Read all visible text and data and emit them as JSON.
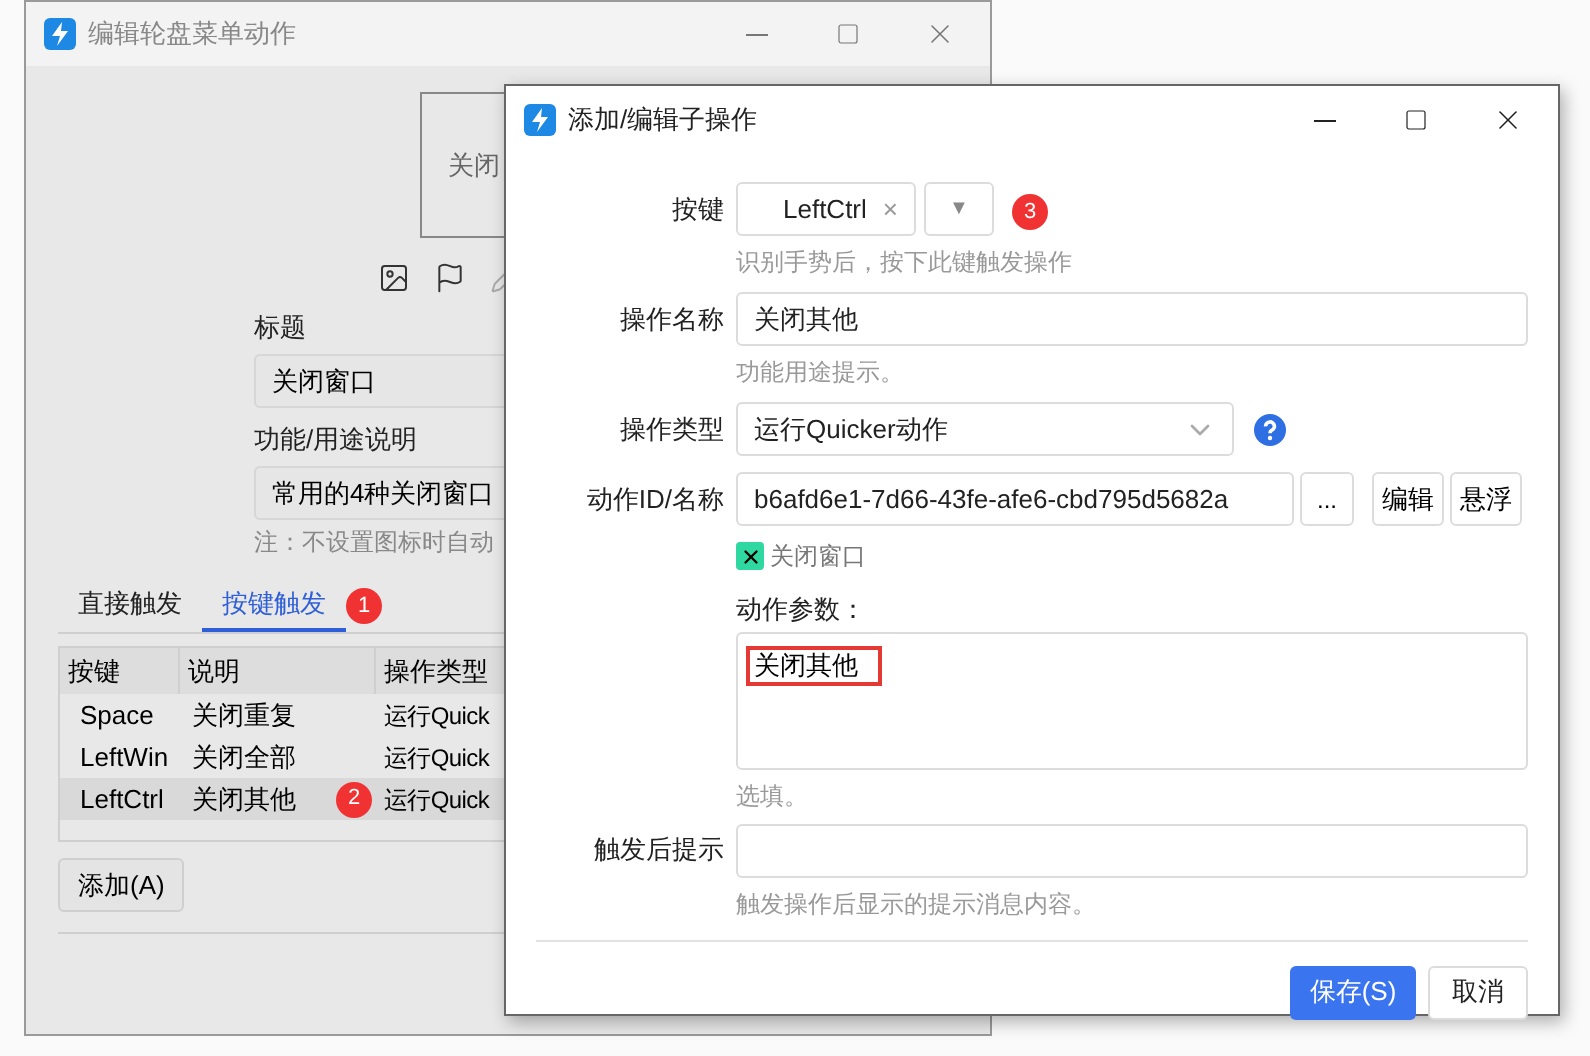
{
  "back_window": {
    "title": "编辑轮盘菜单动作",
    "preview_text": "关闭",
    "title_label": "标题",
    "title_value": "关闭窗口",
    "desc_label": "功能/用途说明",
    "desc_value": "常用的4种关闭窗口",
    "note": "注：不设置图标时自动",
    "tabs": [
      {
        "label": "直接触发",
        "selected": false
      },
      {
        "label": "按键触发",
        "selected": true,
        "badge": "1"
      }
    ],
    "table": {
      "columns": [
        "按键",
        "说明",
        "操作类型"
      ],
      "rows": [
        {
          "cells": [
            "Space",
            "关闭重复",
            "运行Quick"
          ],
          "selected": false
        },
        {
          "cells": [
            "LeftWin",
            "关闭全部",
            "运行Quick"
          ],
          "selected": false
        },
        {
          "cells": [
            "LeftCtrl",
            "关闭其他",
            "运行Quick"
          ],
          "selected": true,
          "badge": "2"
        }
      ]
    },
    "add_button": "添加(A)"
  },
  "front_window": {
    "title": "添加/编辑子操作",
    "key": {
      "label": "按键",
      "value": "LeftCtrl",
      "clear": "×",
      "dropdown": "▼",
      "badge": "3",
      "hint": "识别手势后，按下此键触发操作"
    },
    "name": {
      "label": "操作名称",
      "value": "关闭其他",
      "hint": "功能用途提示。"
    },
    "type": {
      "label": "操作类型",
      "value": "运行Quicker动作"
    },
    "action_id": {
      "label": "动作ID/名称",
      "value": "b6afd6e1-7d66-43fe-afe6-cbd795d5682a",
      "more": "...",
      "buttons": [
        "编辑",
        "悬浮"
      ],
      "linked_action": "关闭窗口"
    },
    "params": {
      "label": "动作参数：",
      "value": "关闭其他",
      "hint": "选填。"
    },
    "tip": {
      "label": "触发后提示",
      "hint": "触发操作后显示的提示消息内容。"
    },
    "buttons": [
      {
        "label": "保存(S)",
        "kind": "primary"
      },
      {
        "label": "取消",
        "kind": "secondary"
      }
    ]
  }
}
